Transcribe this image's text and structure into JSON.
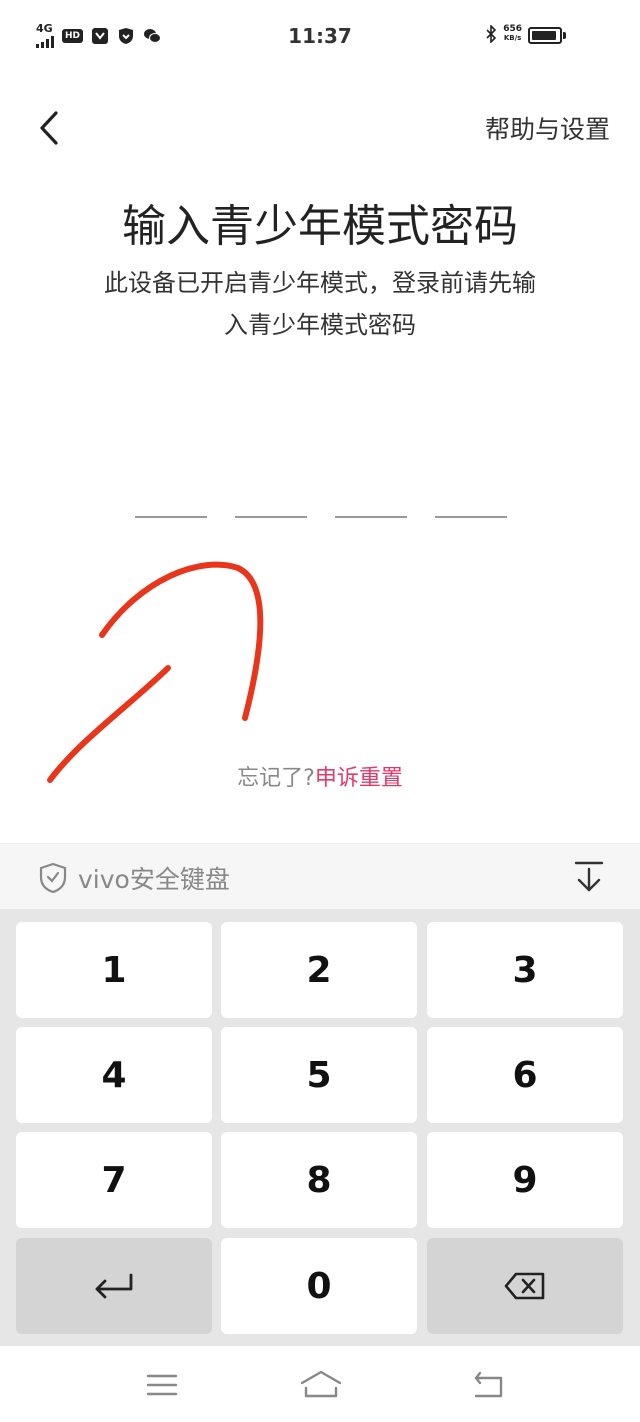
{
  "status_bar": {
    "network": "4G",
    "hd": "HD",
    "time": "11:37",
    "speed_value": "656",
    "speed_unit": "KB/s",
    "icons": [
      "signal-icon",
      "hd-icon",
      "app-icon",
      "shield-icon",
      "wechat-icon",
      "bluetooth-icon",
      "battery-icon"
    ]
  },
  "header": {
    "back_icon": "chevron-left-icon",
    "help_label": "帮助与设置"
  },
  "main": {
    "title": "输入青少年模式密码",
    "desc_line1": "此设备已开启青少年模式，登录前请先输",
    "desc_line2": "入青少年模式密码",
    "pin_length": 4,
    "forgot_text": "忘记了?",
    "appeal_link": "申诉重置"
  },
  "keyboard": {
    "brand": "vivo安全键盘",
    "collapse_icon": "collapse-keyboard-icon",
    "keys": [
      "1",
      "2",
      "3",
      "4",
      "5",
      "6",
      "7",
      "8",
      "9",
      "",
      "0",
      ""
    ],
    "enter_icon": "enter-icon",
    "delete_icon": "backspace-icon"
  },
  "nav_bar": {
    "icons": [
      "menu-icon",
      "home-icon",
      "back-nav-icon"
    ]
  },
  "colors": {
    "accent": "#e23b6a",
    "annotation": "#e8361c",
    "keyboard_bg": "#e6e6e6"
  }
}
